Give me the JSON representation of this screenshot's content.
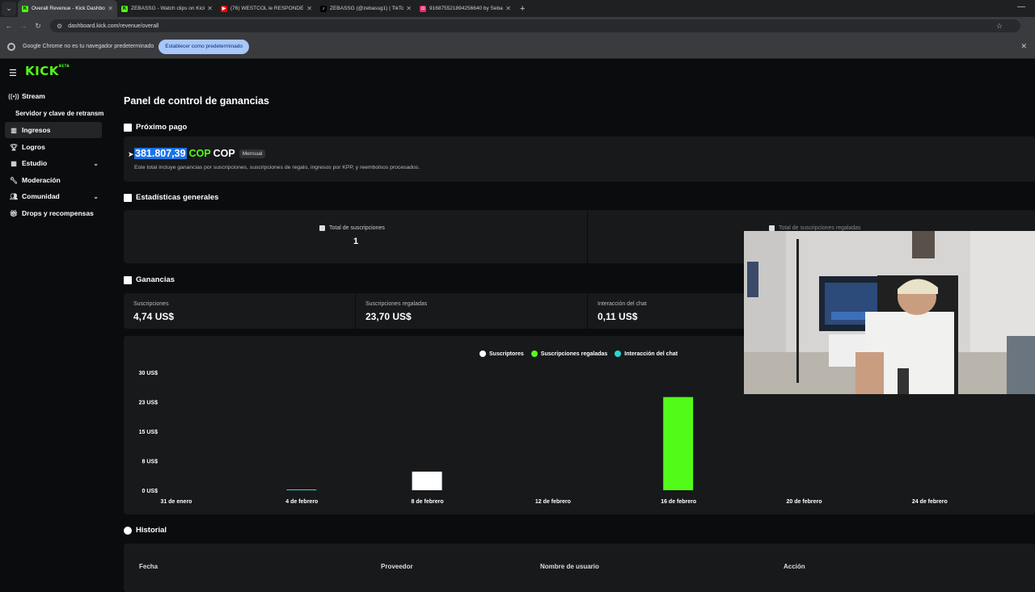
{
  "browser": {
    "tabs": [
      {
        "title": "Overall Revenue - Kick Dashbo",
        "fav_color": "#53fc18",
        "fav": "K",
        "active": true
      },
      {
        "title": "ZEBASSG - Watch clips on Kick",
        "fav_color": "#53fc18",
        "fav": "K",
        "active": false
      },
      {
        "title": "(76) WESTCOL le RESPONDE y",
        "fav_color": "#ff0000",
        "fav": "▶",
        "active": false
      },
      {
        "title": "ZEBASSG (@zebassg1) | TikTok",
        "fav_color": "#000000",
        "fav": "♪",
        "active": false
      },
      {
        "title": "916875521894256640 by Sebas",
        "fav_color": "#e1306c",
        "fav": "◘",
        "active": false
      }
    ],
    "url": "dashboard.kick.com/revenue/overall",
    "infobar_text": "Google Chrome no es tu navegador predeterminado",
    "infobar_button": "Establecer como predeterminado"
  },
  "sidebar": {
    "logo": "KICK",
    "logo_sup": "BETA",
    "items": [
      {
        "label": "Stream",
        "icon": "broadcast-icon"
      },
      {
        "label": "Ingresos",
        "icon": "chart-icon"
      },
      {
        "label": "Logros",
        "icon": "trophy-icon"
      },
      {
        "label": "Estudio",
        "icon": "film-icon"
      },
      {
        "label": "Moderación",
        "icon": "wrench-icon"
      },
      {
        "label": "Comunidad",
        "icon": "people-icon"
      },
      {
        "label": "Drops y recompensas",
        "icon": "gift-icon"
      }
    ],
    "sub_item": "Servidor y clave de retransm"
  },
  "main": {
    "title": "Panel de control de ganancias",
    "next_payment": {
      "heading": "Próximo pago",
      "amount": "381.807,39",
      "currency_green": "COP",
      "currency_white": "COP",
      "badge": "Mensual",
      "note": "Este total incluye ganancias por suscripciones, suscripciones de regalo, ingresos por KPP, y reembolsos procesados."
    },
    "stats": {
      "heading": "Estadísticas generales",
      "total_subs_label": "Total de suscripciones",
      "total_subs_value": "1",
      "gifted_label": "Total de suscripciones regaladas"
    },
    "earnings": {
      "heading": "Ganancias",
      "cards": [
        {
          "label": "Suscripciones",
          "value": "4,74 US$"
        },
        {
          "label": "Suscripciones regaladas",
          "value": "23,70 US$"
        },
        {
          "label": "Interacción del chat",
          "value": "0,11 US$"
        }
      ]
    },
    "history": {
      "heading": "Historial",
      "columns": [
        "Fecha",
        "Proveedor",
        "Nombre de usuario",
        "Acción"
      ]
    }
  },
  "chart_data": {
    "type": "bar",
    "categories": [
      "31 de enero",
      "4 de febrero",
      "8 de febrero",
      "12 de febrero",
      "16 de febrero",
      "20 de febrero",
      "24 de febrero"
    ],
    "y_ticks": [
      "0 US$",
      "8 US$",
      "15 US$",
      "23 US$",
      "30 US$"
    ],
    "ylim": [
      0,
      30
    ],
    "series": [
      {
        "name": "Suscriptores",
        "color": "#ffffff",
        "values": [
          0,
          0,
          4.74,
          0,
          0,
          0,
          0
        ]
      },
      {
        "name": "Suscripciones regaladas",
        "color": "#53fc18",
        "values": [
          0,
          0,
          0,
          0,
          23.7,
          0,
          0
        ]
      },
      {
        "name": "Interacción del chat",
        "color": "#2ad7d0",
        "values": [
          0,
          0.11,
          0,
          0,
          0,
          0,
          0
        ]
      }
    ]
  }
}
